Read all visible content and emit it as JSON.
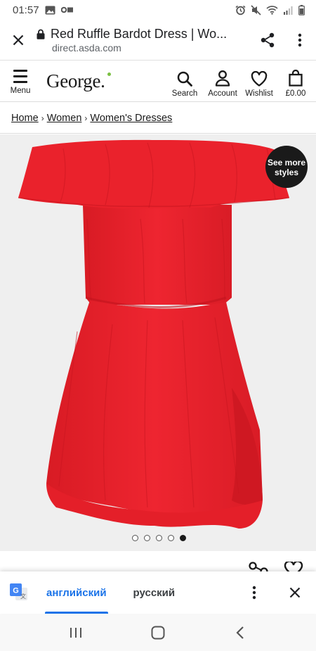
{
  "status_bar": {
    "time": "01:57",
    "icons": [
      "image-icon",
      "vr-icon",
      "alarm-icon",
      "mute-icon",
      "wifi-icon",
      "signal-icon",
      "battery-icon"
    ]
  },
  "browser": {
    "page_title": "Red Ruffle Bardot Dress | Wo...",
    "url": "direct.asda.com",
    "icons": [
      "close-icon",
      "lock-icon",
      "share-icon",
      "more-vert-icon"
    ]
  },
  "header": {
    "menu_label": "Menu",
    "logo_text": "George",
    "search_label": "Search",
    "account_label": "Account",
    "wishlist_label": "Wishlist",
    "basket_total": "£0.00"
  },
  "breadcrumb": [
    "Home",
    "Women",
    "Women's Dresses"
  ],
  "gallery": {
    "see_more_line1": "See more",
    "see_more_line2": "styles",
    "image_count": 5,
    "active_index": 4,
    "product_color": "#e81f2a",
    "background": "#efefef"
  },
  "translate_bar": {
    "source_lang": "английский",
    "target_lang": "русский",
    "accent": "#1a73e8"
  },
  "nav_bar": {
    "icons": [
      "recent-apps-icon",
      "home-icon",
      "back-icon"
    ]
  }
}
